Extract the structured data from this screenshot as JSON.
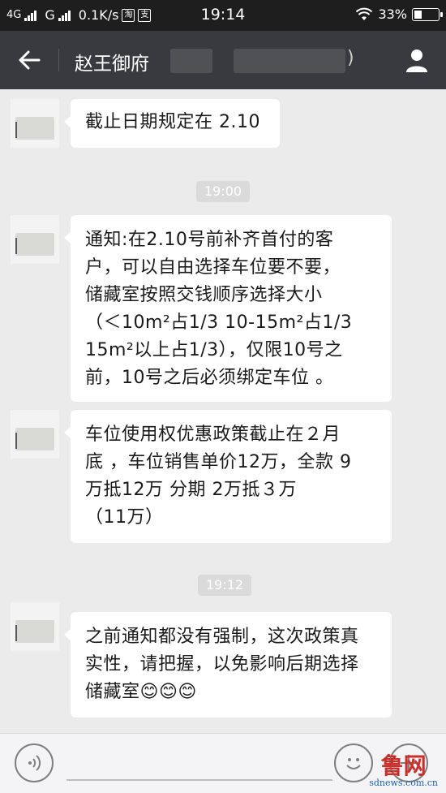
{
  "status_bar": {
    "network1": "4G",
    "network2": "G",
    "speed": "0.1K/s",
    "app_icon1": "淘",
    "app_icon2": "支",
    "time": "19:14",
    "battery": "33%",
    "battery_level": 0.33,
    "icons": [
      "signal-icon",
      "wifi-icon",
      "battery-icon"
    ]
  },
  "header": {
    "title": "赵王御府",
    "title_suffix": ")",
    "icons": [
      "back-arrow-icon",
      "profile-icon"
    ]
  },
  "messages": [
    {
      "lines": [
        "截止日期规定在 2.10"
      ]
    },
    {
      "lines": [
        "通知:在2.10号前补齐首付的客",
        "户，可以自由选择车位要不要，",
        "储藏室按照交钱顺序选择大小",
        "（＜10m²占1/3   10-15m²占1/3",
        "15m²以上占1/3），仅限10号之",
        "前，10号之后必须绑定车位 。"
      ]
    },
    {
      "lines": [
        "车位使用权优惠政策截止在２月",
        "底 ，车位销售单价12万，全款  9",
        "万抵12万   分期     2万抵３万",
        "（11万）"
      ]
    },
    {
      "lines": [
        "之前通知都没有强制，这次政策真",
        "实性，请把握，以免影响后期选择",
        "储藏室"
      ],
      "emoji": "😊😊😊"
    }
  ],
  "timestamps": [
    "19:00",
    "19:12"
  ],
  "input_bar": {
    "icons": [
      "voice-icon",
      "emoji-icon",
      "plus-icon"
    ]
  },
  "watermark": {
    "text": "鲁网",
    "url": "sdnews.com.cn"
  },
  "colors": {
    "status_bar_bg": "#1e1e1e",
    "title_bar_bg": "#393a3f",
    "chat_bg": "#ebebeb",
    "bubble_bg": "#ffffff",
    "timestamp_bg": "#dadada"
  }
}
